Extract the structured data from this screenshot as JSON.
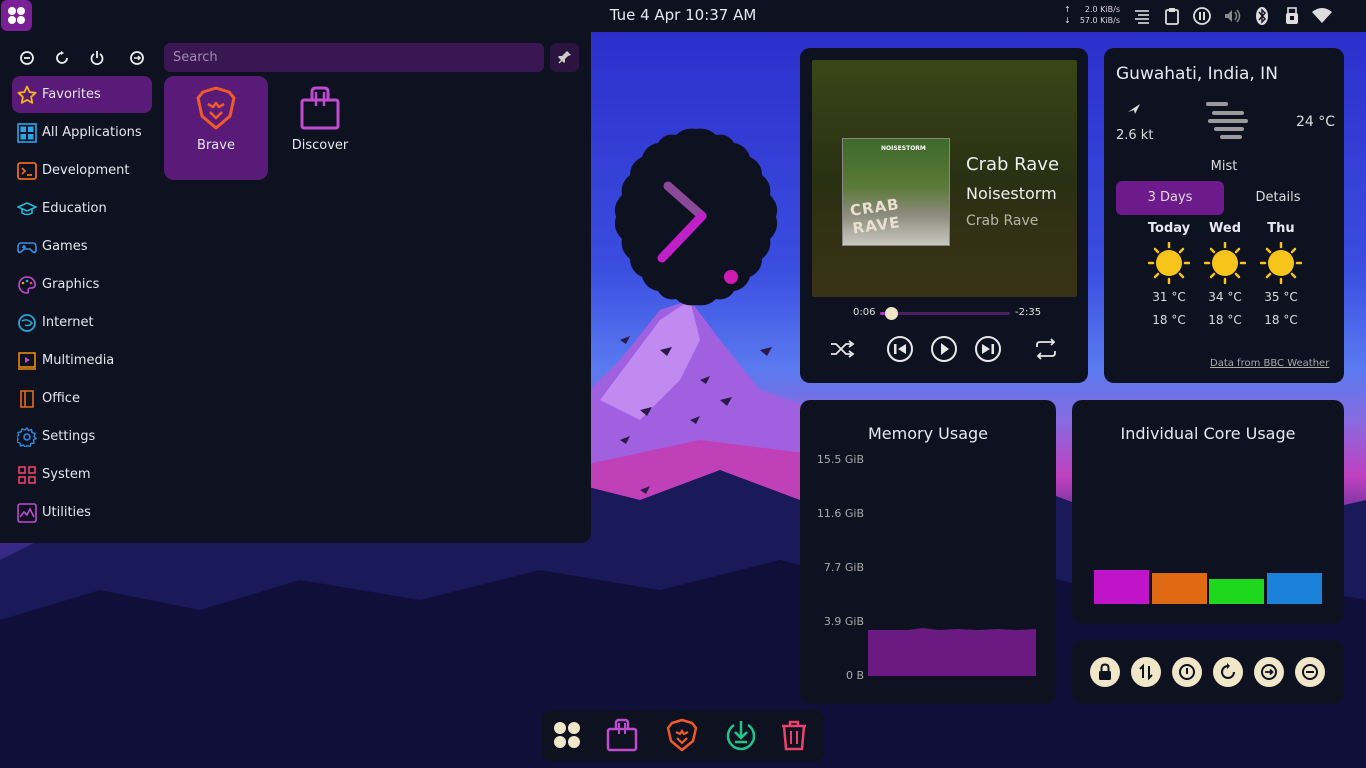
{
  "panel": {
    "datetime": "Tue 4 Apr 10:37 AM",
    "net_up": "2.0 KiB/s",
    "net_down": "57.0 KiB/s",
    "net_up_arrow": "↑",
    "net_down_arrow": "↓",
    "tray_icons": [
      "task-manager-icon",
      "clipboard-icon",
      "media-pause-icon",
      "volume-icon",
      "bluetooth-icon",
      "hardware-icon",
      "wifi-icon"
    ]
  },
  "menu": {
    "search_placeholder": "Search",
    "power_buttons": [
      "lock-screen",
      "restart",
      "shutdown",
      "logout"
    ],
    "categories": [
      {
        "label": "Favorites",
        "icon": "star-icon",
        "color": "#f2b51e"
      },
      {
        "label": "All Applications",
        "icon": "grid-icon",
        "color": "#2aa6e8"
      },
      {
        "label": "Development",
        "icon": "terminal-icon",
        "color": "#ea6a1c"
      },
      {
        "label": "Education",
        "icon": "graduation-cap-icon",
        "color": "#22b8d8"
      },
      {
        "label": "Games",
        "icon": "gamepad-icon",
        "color": "#3a8de0"
      },
      {
        "label": "Graphics",
        "icon": "palette-icon",
        "color": "#c04bd0"
      },
      {
        "label": "Internet",
        "icon": "globe-icon",
        "color": "#22a8d8"
      },
      {
        "label": "Multimedia",
        "icon": "play-screen-icon",
        "color": "#e88a12"
      },
      {
        "label": "Office",
        "icon": "book-icon",
        "color": "#ea6a1c"
      },
      {
        "label": "Settings",
        "icon": "gear-icon",
        "color": "#2a8ce0"
      },
      {
        "label": "System",
        "icon": "system-grid-icon",
        "color": "#e8436a"
      },
      {
        "label": "Utilities",
        "icon": "chart-icon",
        "color": "#c04bd0"
      }
    ],
    "apps": [
      {
        "label": "Brave",
        "icon": "brave-lion-icon"
      },
      {
        "label": "Discover",
        "icon": "shopping-bag-icon"
      }
    ]
  },
  "media": {
    "title": "Crab Rave",
    "artist": "Noisestorm",
    "album": "Crab Rave",
    "cover_title": "CRAB RAVE",
    "cover_brand": "NOISESTORM",
    "position": "0:06",
    "remaining": "-2:35",
    "progress_fraction": 0.04
  },
  "weather": {
    "location": "Guwahati, India, IN",
    "wind": "2.6 kt",
    "temperature": "24 °C",
    "condition": "Mist",
    "tab_active": "3 Days",
    "tab_other": "Details",
    "forecast": [
      {
        "day": "Today",
        "high": "31 °C",
        "low": "18 °C"
      },
      {
        "day": "Wed",
        "high": "34 °C",
        "low": "18 °C"
      },
      {
        "day": "Thu",
        "high": "35 °C",
        "low": "18 °C"
      }
    ],
    "source": "Data from BBC Weather"
  },
  "memory": {
    "title": "Memory Usage",
    "axis": [
      "15.5 GiB",
      "11.6 GiB",
      "7.7 GiB",
      "3.9 GiB",
      "0 B"
    ],
    "used_gib": 3.6,
    "max_gib": 15.5,
    "color": "#6a1a80"
  },
  "cores": {
    "title": "Individual Core Usage",
    "values": [
      0.48,
      0.44,
      0.36,
      0.44
    ],
    "colors": [
      "#c014c8",
      "#e06a14",
      "#1ed81e",
      "#1a80d8"
    ]
  },
  "session": {
    "buttons": [
      "lock-icon",
      "switch-user-icon",
      "shutdown-icon",
      "restart-icon",
      "logout-icon",
      "standby-icon"
    ]
  },
  "dock": {
    "items": [
      "launcher-icon",
      "discover-icon",
      "brave-icon",
      "download-icon",
      "trash-icon"
    ]
  },
  "colors": {
    "accent": "#7a2096",
    "panel_bg": "#0e1120"
  }
}
